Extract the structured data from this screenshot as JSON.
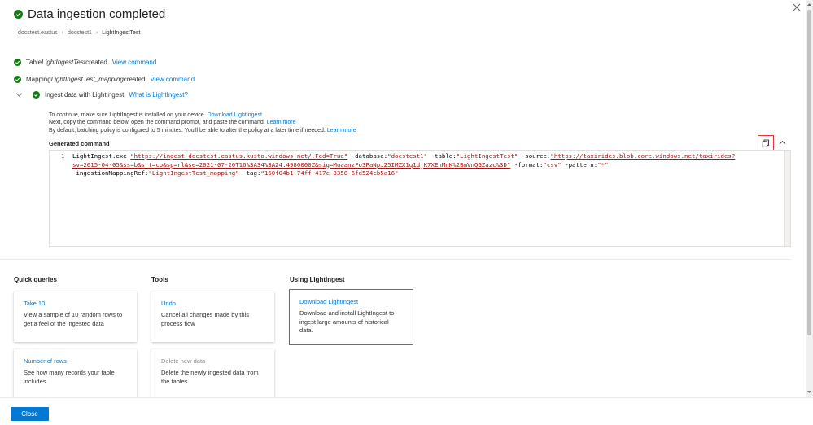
{
  "header": {
    "title": "Data ingestion completed",
    "close_icon": "close-icon",
    "status_icon": "check-circle-icon",
    "status_color": "#107c10"
  },
  "breadcrumb": [
    "docstest.eastus",
    "docstest1",
    "LightIngestTest"
  ],
  "steps": {
    "table": {
      "prefix": "Table ",
      "name": "LightIngestTest",
      "suffix": " created",
      "link": "View command"
    },
    "mapping": {
      "prefix": "Mapping ",
      "name": "LightIngestTest_mapping",
      "suffix": " created",
      "link": "View command"
    },
    "ingest": {
      "label": "Ingest data with LightIngest",
      "link": "What is LightIngest?"
    }
  },
  "info": {
    "line1_text": "To continue, make sure LightIngest is installed on your device. ",
    "line1_link": "Download LightIngest",
    "line2_text": "Next, copy the command below, open the command prompt, and paste the command. ",
    "line2_link": "Learn more",
    "line3_text": "By default, batching policy is configured to 5 minutes. You'll be able to alter the policy at a later time if needed. ",
    "line3_link": "Learn more"
  },
  "command": {
    "label": "Generated command",
    "line_number": "1",
    "copy_icon": "copy-icon",
    "t1": "LightIngest.exe ",
    "t2": "\"https://ingest-docstest.eastus.kusto.windows.net/;Fed=True\"",
    "t3": " -database:",
    "t4": "\"docstest1\"",
    "t5": " -table:",
    "t6": "\"LightIngestTest\"",
    "t7": " -source:",
    "t8": "\"https://taxirides.blob.core.windows.net/taxirides?",
    "t9": "sv=2015-04-05&ss=b&srt=co&sp=rl&se=2021-07-20T16%3A34%3A24.4980000Z&sig=MuaanzFo3PaNpi25IMZX1q1djK7XEhMnK%2BmVnQGZazc%3D\"",
    "t10": " -format:",
    "t11": "\"csv\"",
    "t12": " -pattern:",
    "t13": "\"*\"",
    "t14": "-ingestionMappingRef:",
    "t15": "\"LightIngestTest_mapping\"",
    "t16": " -tag:",
    "t17": "\"160f04b1-74ff-417c-8358-6fd524cb5a16\""
  },
  "sections": {
    "quick_queries": "Quick queries",
    "tools": "Tools",
    "using": "Using LightIngest"
  },
  "cards": {
    "take10": {
      "title": "Take 10",
      "desc": "View a sample of 10 random rows to get a feel of the ingested data"
    },
    "num_rows": {
      "title": "Number of rows",
      "desc": "See how many records your table includes"
    },
    "undo": {
      "title": "Undo",
      "desc": "Cancel all changes made by this process flow"
    },
    "delete": {
      "title": "Delete new data",
      "desc": "Delete the newly ingested data from the tables"
    },
    "download": {
      "title": "Download LightIngest",
      "desc": "Download and install LightIngest to ingest large amounts of historical data."
    }
  },
  "footer": {
    "close_label": "Close"
  },
  "colors": {
    "accent": "#0078d4",
    "highlight": "#e03b3b",
    "success": "#107c10"
  }
}
